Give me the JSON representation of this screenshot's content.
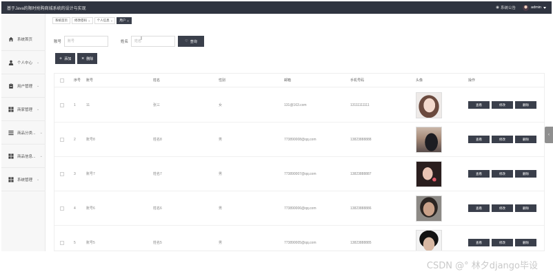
{
  "app": {
    "title": "基于Java的限时抢购商城系统的设计与实现",
    "notice_label": "系统公告",
    "user_label": "admin"
  },
  "sidebar": {
    "items": [
      {
        "label": "系统首页",
        "icon": "home-icon",
        "chevron": ""
      },
      {
        "label": "个人中心",
        "icon": "user-icon",
        "chevron": "⌄"
      },
      {
        "label": "用户管理",
        "icon": "clipboard-icon",
        "chevron": "⌄"
      },
      {
        "label": "商家管理",
        "icon": "grid-icon",
        "chevron": "⌄"
      },
      {
        "label": "商品分类...",
        "icon": "list-icon",
        "chevron": "⌄"
      },
      {
        "label": "商品信息...",
        "icon": "grid-icon",
        "chevron": "⌄"
      },
      {
        "label": "系统管理",
        "icon": "grid-icon",
        "chevron": "⌄"
      }
    ]
  },
  "tabs": [
    {
      "label": "系统首页",
      "closable": false,
      "active": false
    },
    {
      "label": "修改密码",
      "closable": true,
      "active": false
    },
    {
      "label": "个人信息",
      "closable": true,
      "active": false
    },
    {
      "label": "用户",
      "closable": true,
      "active": true
    }
  ],
  "search": {
    "account_label": "账号",
    "account_placeholder": "账号",
    "name_label": "姓名",
    "name_placeholder": "姓名",
    "query_label": "查询"
  },
  "actions": {
    "add_label": "添加",
    "delete_label": "删除"
  },
  "table": {
    "columns": [
      "序号",
      "账号",
      "姓名",
      "性别",
      "邮箱",
      "手机号码",
      "头像",
      "操作"
    ],
    "rows": [
      {
        "index": "1",
        "account": "11",
        "name": "张三",
        "gender": "女",
        "email": "131@163.com",
        "phone": "13111111111",
        "photo": "avatar-woman-short-hair"
      },
      {
        "index": "2",
        "account": "账号8",
        "name": "姓名8",
        "gender": "男",
        "email": "773890008@qq.com",
        "phone": "13823888888",
        "photo": "avatar-sunset-silhouette"
      },
      {
        "index": "3",
        "account": "账号7",
        "name": "姓名7",
        "gender": "男",
        "email": "773890007@qq.com",
        "phone": "13823888887",
        "photo": "avatar-girl-long-hair"
      },
      {
        "index": "4",
        "account": "账号6",
        "name": "姓名6",
        "gender": "男",
        "email": "773890006@qq.com",
        "phone": "13823888886",
        "photo": "avatar-man-beard"
      },
      {
        "index": "5",
        "account": "账号5",
        "name": "姓名5",
        "gender": "男",
        "email": "773890005@qq.com",
        "phone": "13823888885",
        "photo": "avatar-man-dark"
      }
    ],
    "ops": {
      "view": "查看",
      "edit": "修改",
      "delete": "删除"
    }
  },
  "watermark": "CSDN @°  林夕django毕设",
  "colors": {
    "topbar": "#2f3440",
    "button": "#3a3f4b",
    "sidebar": "#f7f7f7"
  }
}
